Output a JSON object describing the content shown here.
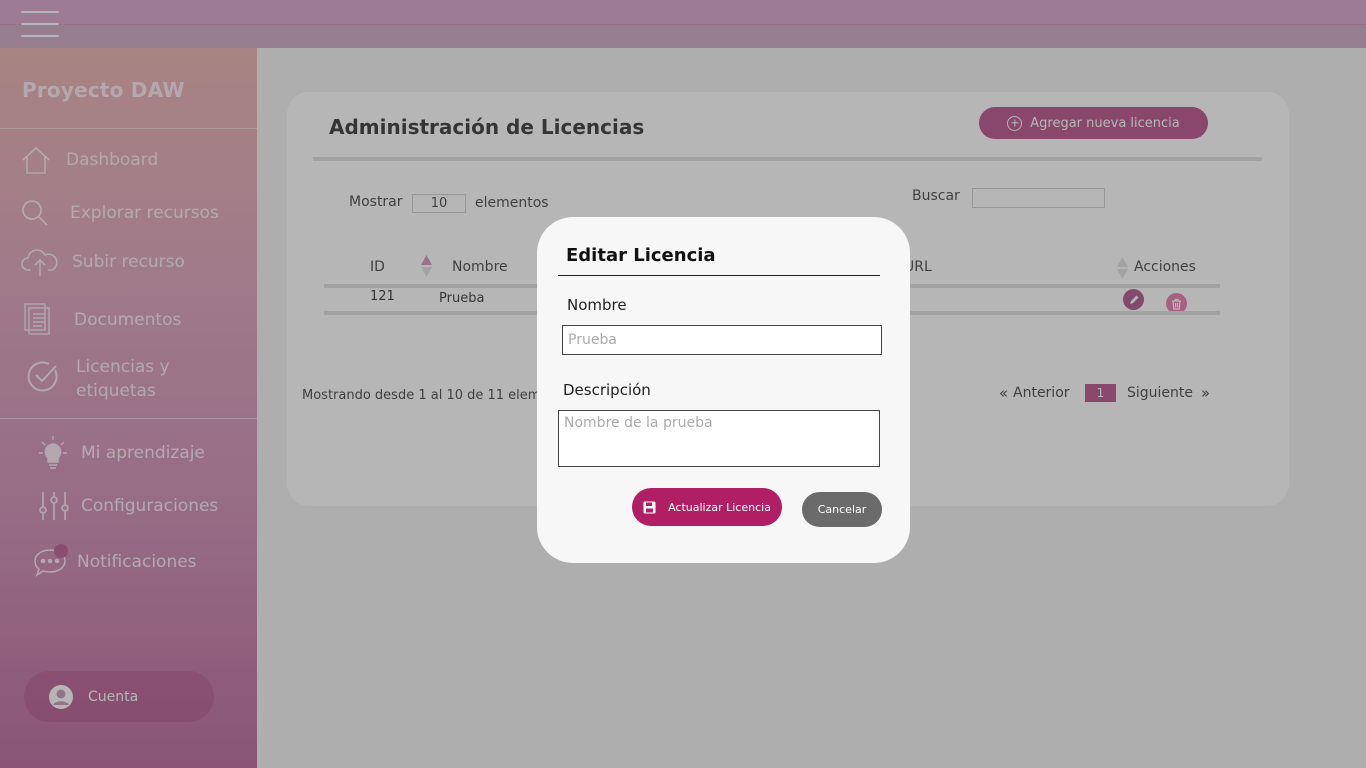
{
  "sidebar": {
    "brand": "Proyecto DAW",
    "items": [
      {
        "label": "Dashboard"
      },
      {
        "label": "Explorar recursos"
      },
      {
        "label": "Subir recurso"
      },
      {
        "label": "Documentos"
      },
      {
        "label": "Licencias y etiquetas"
      },
      {
        "label": "Mi aprendizaje"
      },
      {
        "label": "Configuraciones"
      },
      {
        "label": "Notificaciones"
      }
    ],
    "account_label": "Cuenta"
  },
  "main": {
    "title": "Administración de Licencias",
    "add_button": "Agregar nueva licencia",
    "show_label": "Mostrar",
    "page_length": "10",
    "elements_label": "elementos",
    "search_label": "Buscar",
    "columns": [
      "ID",
      "Nombre",
      "URL",
      "Acciones"
    ],
    "rows": [
      {
        "id": "121",
        "nombre": "Prueba"
      }
    ],
    "info_text": "Mostrando desde 1 al 10 de 11 elementos",
    "prev_label": "Anterior",
    "next_label": "Siguiente",
    "current_page": "1"
  },
  "modal": {
    "title": "Editar Licencia",
    "name_label": "Nombre",
    "name_placeholder": "Prueba",
    "desc_label": "Descripción",
    "desc_placeholder": "Nombre de la prueba",
    "update_button": "Actualizar Licencia",
    "cancel_button": "Cancelar"
  },
  "colors": {
    "accent": "#b2437e",
    "update_button": "#b01f66",
    "cancel_button": "#6b6b6b"
  }
}
